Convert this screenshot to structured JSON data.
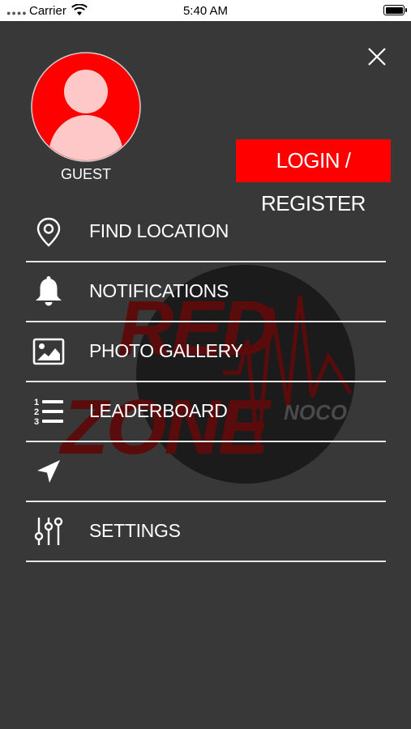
{
  "status_bar": {
    "carrier": "Carrier",
    "time": "5:40 AM"
  },
  "profile": {
    "name": "GUEST"
  },
  "login_button": {
    "label": "LOGIN / REGISTER"
  },
  "menu": {
    "items": [
      {
        "label": "FIND LOCATION",
        "icon": "location-pin-icon"
      },
      {
        "label": "NOTIFICATIONS",
        "icon": "bell-icon"
      },
      {
        "label": "PHOTO GALLERY",
        "icon": "image-icon"
      },
      {
        "label": "LEADERBOARD",
        "icon": "numbered-list-icon"
      },
      {
        "label": "",
        "icon": "navigation-arrow-icon"
      },
      {
        "label": "SETTINGS",
        "icon": "sliders-icon"
      }
    ]
  },
  "watermark": {
    "line1": "RED",
    "line2": "ZONE",
    "sub": "NOCO"
  },
  "colors": {
    "background": "#383838",
    "accent": "#ff0000",
    "avatar_fill": "#ffc8c8"
  }
}
